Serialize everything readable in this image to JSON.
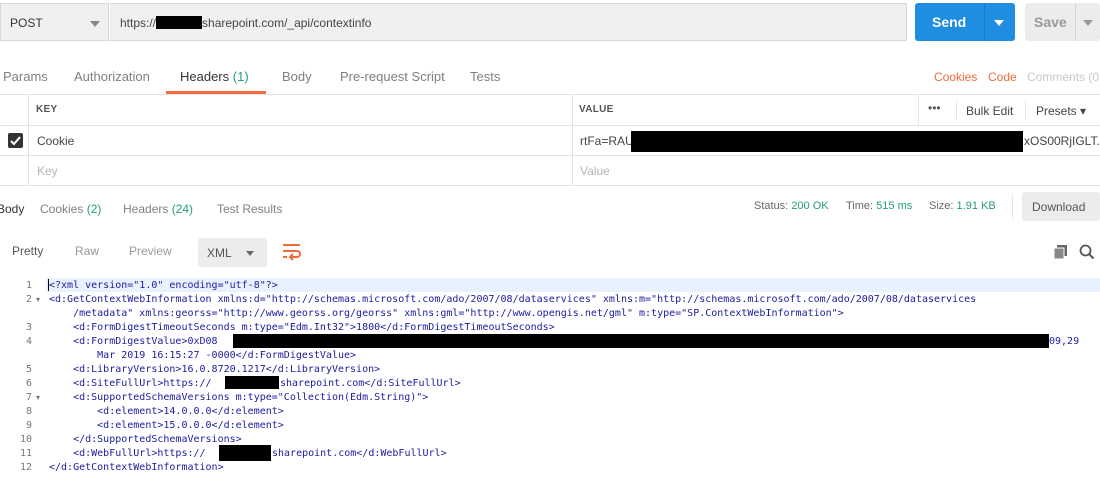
{
  "request": {
    "method": "POST",
    "url_prefix": "https://",
    "url_suffix": "sharepoint.com/_api/contextinfo",
    "send_label": "Send",
    "save_label": "Save"
  },
  "request_tabs": {
    "params": "Params",
    "authorization": "Authorization",
    "headers": "Headers",
    "headers_count": "(1)",
    "body": "Body",
    "prerequest": "Pre-request Script",
    "tests": "Tests",
    "cookies": "Cookies",
    "code": "Code",
    "comments": "Comments (0"
  },
  "headers_table": {
    "key_header": "KEY",
    "value_header": "VALUE",
    "more": "•••",
    "bulk_edit": "Bulk Edit",
    "presets": "Presets ▾",
    "rows": [
      {
        "key": "Cookie",
        "value_prefix": "rtFa=RAU",
        "value_suffix": "xOS00RjIGLT.."
      }
    ],
    "key_placeholder": "Key",
    "value_placeholder": "Value"
  },
  "response_tabs": {
    "body": "Body",
    "cookies": "Cookies",
    "cookies_count": "(2)",
    "headers": "Headers",
    "headers_count": "(24)",
    "test_results": "Test Results"
  },
  "status": {
    "status_label": "Status:",
    "status_value": "200 OK",
    "time_label": "Time:",
    "time_value": "515 ms",
    "size_label": "Size:",
    "size_value": "1.91 KB",
    "download_label": "Download"
  },
  "format_bar": {
    "pretty": "Pretty",
    "raw": "Raw",
    "preview": "Preview",
    "format": "XML"
  },
  "code": {
    "line_numbers": [
      "1",
      "2",
      "",
      "3",
      "4",
      "",
      "5",
      "6",
      "7",
      "8",
      "9",
      "10",
      "11",
      "12"
    ],
    "l1": "<?xml version=\"1.0\" encoding=\"utf-8\"?>",
    "l2a": "<d:GetContextWebInformation xmlns:d=\"http://schemas.microsoft.com/ado/2007/08/dataservices\" xmlns:m=\"http://schemas.microsoft.com/ado/2007/08/dataservices",
    "l2b": "    /metadata\" xmlns:georss=\"http://www.georss.org/georss\" xmlns:gml=\"http://www.opengis.net/gml\" m:type=\"SP.ContextWebInformation\">",
    "l3": "    <d:FormDigestTimeoutSeconds m:type=\"Edm.Int32\">1800</d:FormDigestTimeoutSeconds>",
    "l4a": "    <d:FormDigestValue>0xD08",
    "l4b": "09,29",
    "l4c": "        Mar 2019 16:15:27 -0000</d:FormDigestValue>",
    "l5": "    <d:LibraryVersion>16.0.8720.1217</d:LibraryVersion>",
    "l6a": "    <d:SiteFullUrl>https://",
    "l6b": "sharepoint.com</d:SiteFullUrl>",
    "l7": "    <d:SupportedSchemaVersions m:type=\"Collection(Edm.String)\">",
    "l8": "        <d:element>14.0.0.0</d:element>",
    "l9": "        <d:element>15.0.0.0</d:element>",
    "l10": "    </d:SupportedSchemaVersions>",
    "l11a": "    <d:WebFullUrl>https://",
    "l11b": "sharepoint.com</d:WebFullUrl>",
    "l12": "</d:GetContextWebInformation>"
  },
  "colors": {
    "accent": "#f26b3a",
    "send": "#1f8de0",
    "success": "#23a16e"
  }
}
